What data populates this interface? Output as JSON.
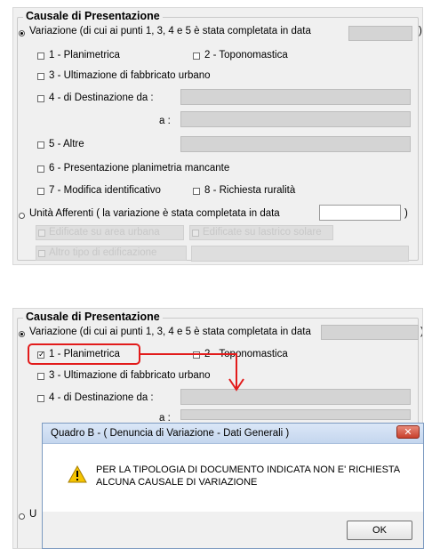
{
  "group_title": "Causale di Presentazione",
  "variazione_label": "Variazione (di cui ai punti 1, 3, 4 e 5 è stata completata in data",
  "variazione_paren": ")",
  "checkboxes": {
    "c1": "1 - Planimetrica",
    "c2": "2 - Toponomastica",
    "c3": "3 - Ultimazione di fabbricato urbano",
    "c4": "4 - di Destinazione da :",
    "c4_a": "a :",
    "c5": "5 - Altre",
    "c6": "6 - Presentazione planimetria mancante",
    "c7": "7 - Modifica identificativo",
    "c8": "8 - Richiesta ruralità"
  },
  "unita_label": "Unità Afferenti ( la variazione è stata completata in data",
  "unita_paren": ")",
  "disabled": {
    "d1": "Edificate su area urbana",
    "d2": "Edificate su lastrico solare",
    "d3": "Altro tipo di edificazione"
  },
  "panel2": {
    "c1_checked": "☑",
    "partial_u": "U"
  },
  "dialog": {
    "title": "Quadro B - ( Denuncia di Variazione - Dati Generali )",
    "close": "✕",
    "message_line1": "PER LA TIPOLOGIA DI DOCUMENTO INDICATA NON E' RICHIESTA",
    "message_line2": "ALCUNA CAUSALE DI VARIAZIONE",
    "ok": "OK"
  },
  "colors": {
    "highlight": "#e21b1b",
    "panel_bg": "#f0f0f0",
    "field_bg": "#d4d4d4"
  }
}
